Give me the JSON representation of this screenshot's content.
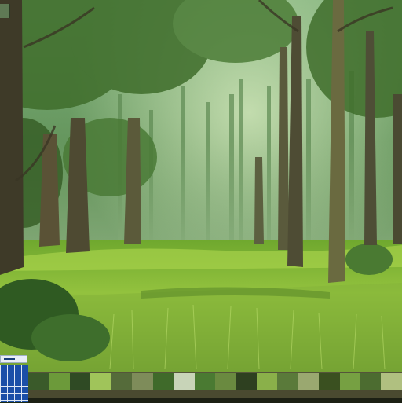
{
  "scene": {
    "description_color_sky": "#cfe3c0",
    "canopy_color": "#3f6d2b",
    "grass_color": "#8fbf3a",
    "trunk_color": "#4a4530"
  },
  "hud": {
    "minimap_icon": "grid-map-icon",
    "hotbar_swatches": [
      "#3a5a2a",
      "#6c9a3a",
      "#2f4a24",
      "#a0c45a",
      "#556b3a",
      "#7e8c5a",
      "#3f6a2a",
      "#c8d4b8",
      "#4a7a32",
      "#6a8a40",
      "#2e4020",
      "#8ab04a",
      "#5a7a3a",
      "#9aa870",
      "#3a5020",
      "#76a042",
      "#4c6c30",
      "#b0c080"
    ]
  }
}
